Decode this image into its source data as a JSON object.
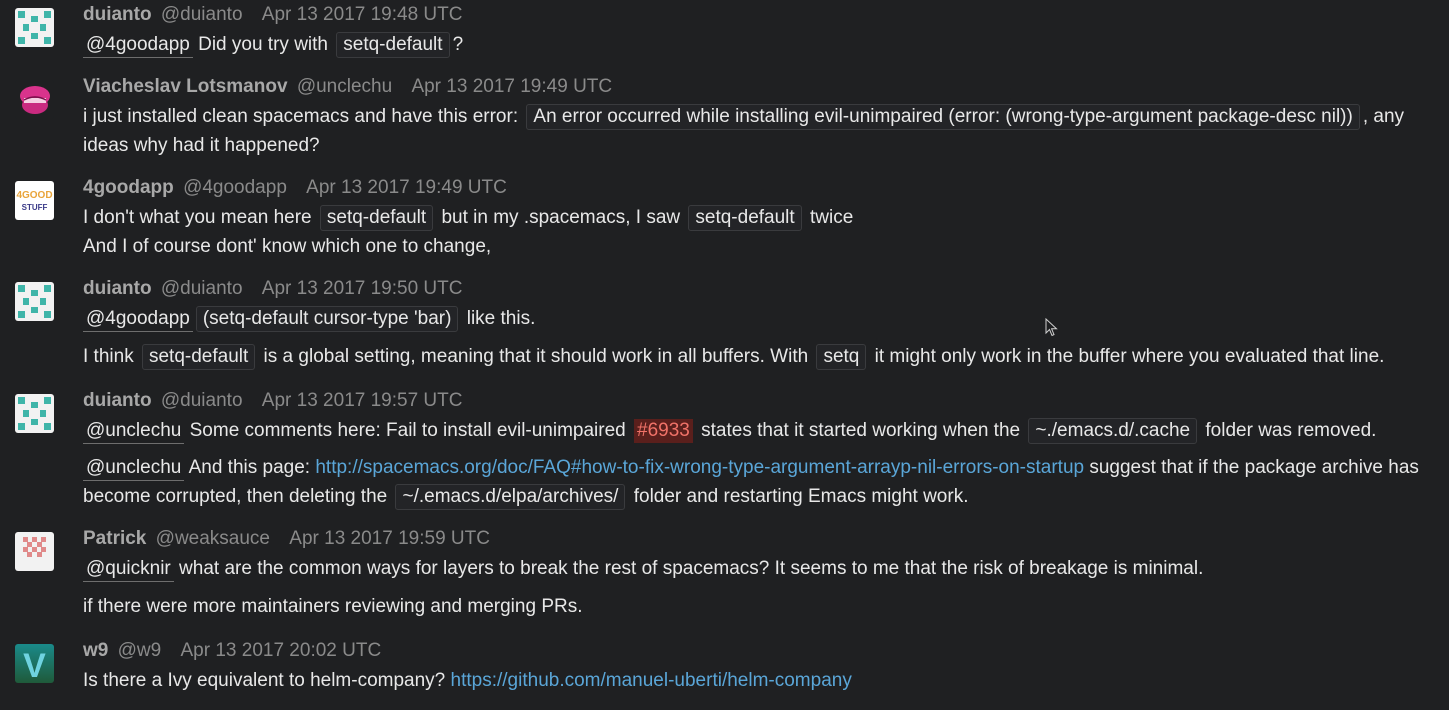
{
  "messages": [
    {
      "displayname": "duianto",
      "username": "@duianto",
      "time": "Apr 13 2017 19:48 UTC",
      "mention": "@4goodapp",
      "text1": " Did you try with ",
      "code1": "setq-default",
      "text2": "?"
    },
    {
      "displayname": "Viacheslav Lotsmanov",
      "username": "@unclechu",
      "time": "Apr 13 2017 19:49 UTC",
      "text1": "i just installed clean spacemacs and have this error: ",
      "code1": "An error occurred while installing evil-unimpaired (error: (wrong-type-argument package-desc nil))",
      "text2": ", any ideas why had it happened?"
    },
    {
      "displayname": "4goodapp",
      "username": "@4goodapp",
      "time": "Apr 13 2017 19:49 UTC",
      "text1": "I don't what you mean here ",
      "code1": "setq-default",
      "text2": " but in my .spacemacs, I saw ",
      "code2": "setq-default",
      "text3": " twice",
      "line2": "And I of course dont' know which one to change,"
    },
    {
      "displayname": "duianto",
      "username": "@duianto",
      "time": "Apr 13 2017 19:50 UTC",
      "mention": "@4goodapp",
      "code1": "(setq-default cursor-type 'bar)",
      "text1": " like this.",
      "l2_text1": "I think ",
      "l2_code1": "setq-default",
      "l2_text2": " is a global setting, meaning that it should work in all buffers. With ",
      "l2_code2": "setq",
      "l2_text3": " it might only work in the buffer where you evaluated that line."
    },
    {
      "displayname": "duianto",
      "username": "@duianto",
      "time": "Apr 13 2017 19:57 UTC",
      "mention": "@unclechu",
      "text1": " Some comments here: Fail to install evil-unimpaired ",
      "issue": "#6933",
      "text2": " states that it started working when the ",
      "code1": "~./emacs.d/.cache",
      "text3": " folder was removed.",
      "l2_mention": "@unclechu",
      "l2_text1": " And this page: ",
      "l2_link": "http://spacemacs.org/doc/FAQ#how-to-fix-wrong-type-argument-arrayp-nil-errors-on-startup",
      "l2_text2": " suggest that if the package archive has become corrupted, then deleting the ",
      "l2_code1": "~/.emacs.d/elpa/archives/",
      "l2_text3": " folder and restarting Emacs might work."
    },
    {
      "displayname": "Patrick",
      "username": "@weaksauce",
      "time": "Apr 13 2017 19:59 UTC",
      "mention": "@quicknir",
      "text1": " what are the common ways for layers to break the rest of spacemacs? It seems to me that the risk of breakage is minimal.",
      "line2": "if there were more maintainers reviewing and merging PRs."
    },
    {
      "displayname": "w9",
      "username": "@w9",
      "time": "Apr 13 2017 20:02 UTC",
      "text1": "Is there a Ivy equivalent to helm-company? ",
      "link": "https://github.com/manuel-uberti/helm-company"
    }
  ],
  "avatars": {
    "duianto": "identicon-teal",
    "unclechu": "pink-lips",
    "4goodapp": "4GOOD STUFF",
    "weaksauce": "identicon-pink",
    "w9": "V"
  },
  "colors": {
    "background": "#1f2022",
    "link": "#5aa6d8",
    "issue_text": "#f07268",
    "issue_bg": "#5a1f1c"
  }
}
